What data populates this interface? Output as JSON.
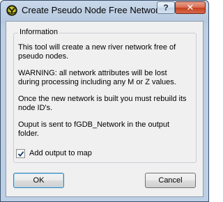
{
  "window": {
    "title": "Create Pseudo Node Free Network",
    "help_label": "?",
    "close_label": "✕"
  },
  "info": {
    "group_label": "Information",
    "paragraphs": [
      "This tool will create a new river network free of\npseudo nodes.",
      "WARNING: all network attributes will be lost\nduring processing including any M or Z values.",
      "Once the new network is built you must rebuild its\nnode ID's.",
      "Ouput is sent to fGDB_Network in the output\nfolder."
    ]
  },
  "add_output": {
    "label": "Add output to map",
    "checked": true
  },
  "buttons": {
    "ok": "OK",
    "cancel": "Cancel"
  },
  "icons": {
    "app": "toolbox-app-icon",
    "help": "help-icon",
    "close": "close-icon",
    "check": "checkmark-icon"
  },
  "colors": {
    "titlebar": "#bccfe4",
    "close_button": "#c4401f",
    "dialog_bg": "#f0f0f0",
    "default_button_border": "#3c7fb1"
  }
}
